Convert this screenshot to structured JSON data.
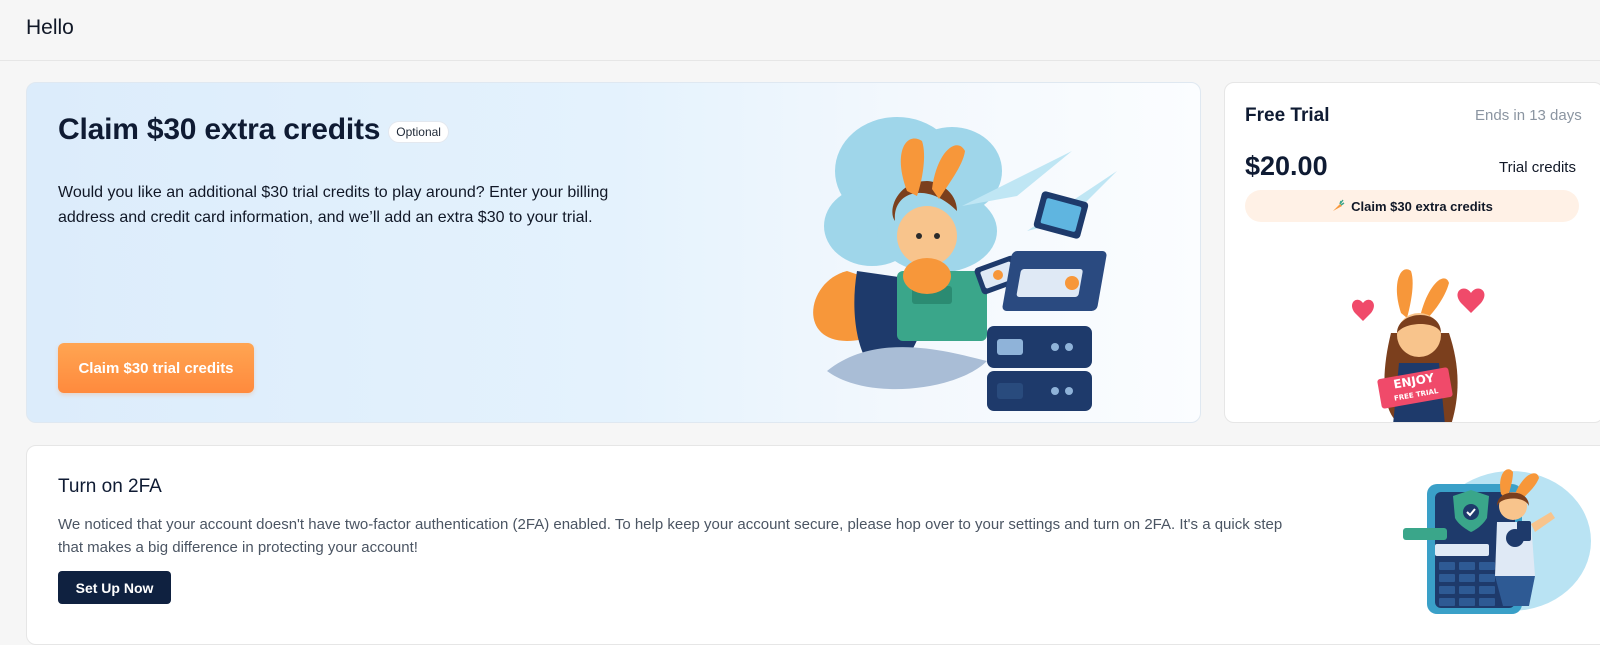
{
  "header": {
    "greeting": "Hello"
  },
  "promo": {
    "title": "Claim $30 extra credits",
    "badge": "Optional",
    "description": "Would you like an additional $30 trial credits to play around? Enter your billing address and credit card information, and we’ll add an extra $30 to your trial.",
    "cta_label": "Claim $30 trial credits",
    "cta_color": "#ff8a3d"
  },
  "trial": {
    "title": "Free Trial",
    "ends": "Ends in 13 days",
    "amount": "$20.00",
    "amount_label": "Trial credits",
    "claim_label": "Claim $30 extra credits",
    "claim_icon": "carrot-icon",
    "sign_line1": "ENJOY",
    "sign_line2": "FREE TRIAL"
  },
  "twofa": {
    "title": "Turn on 2FA",
    "description": "We noticed that your account doesn't have two-factor authentication (2FA) enabled. To help keep your account secure, please hop over to your settings and turn on 2FA. It's a quick step that makes a big difference in protecting your account!",
    "button_label": "Set Up Now",
    "button_color": "#0f2140"
  }
}
